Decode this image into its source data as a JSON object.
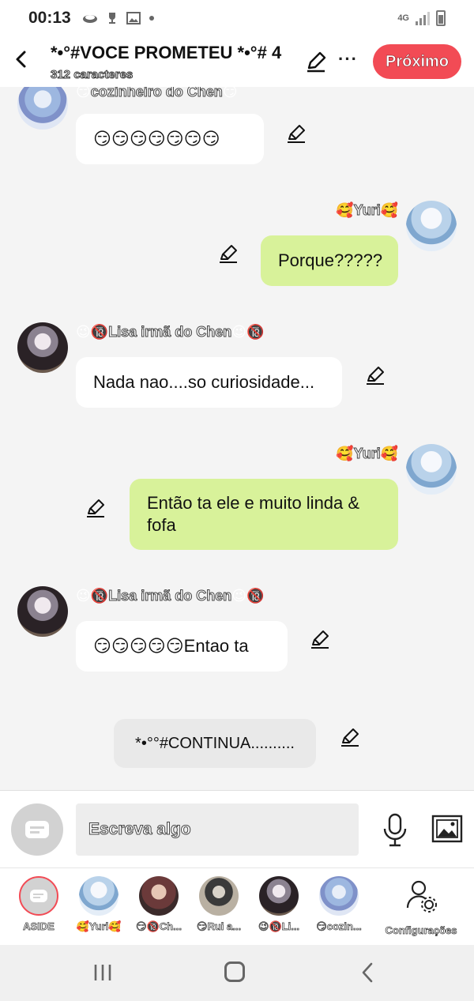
{
  "status": {
    "time": "00:13",
    "network": "4G",
    "icons": [
      "cloud-icon",
      "trophy-icon",
      "image-icon",
      "dot-icon",
      "signal-icon",
      "battery-icon"
    ]
  },
  "header": {
    "title": "*•°#VOCE PROMETEU *•°# 4",
    "subtitle": "312 caracteres",
    "next_label": "Próximo"
  },
  "messages": [
    {
      "side": "left",
      "avatar": "blue",
      "name": "cozinheiro do Chen",
      "name_prefix": "😏",
      "name_suffix": "😏",
      "text": "😏😏😏😏😏😏😏"
    },
    {
      "side": "right",
      "avatar": "yuri",
      "name": "Yuri",
      "name_prefix": "🥰",
      "name_suffix": "🥰",
      "text": "Porque?????"
    },
    {
      "side": "left",
      "avatar": "lisa",
      "name": "Lisa irmã do Chen",
      "name_prefix": "😉🔞",
      "name_suffix": "😉🔞",
      "text": "Nada nao....so curiosidade..."
    },
    {
      "side": "right",
      "avatar": "yuri",
      "name": "Yuri",
      "name_prefix": "🥰",
      "name_suffix": "🥰",
      "text": "Então ta ele e muito linda & fofa"
    },
    {
      "side": "left",
      "avatar": "lisa",
      "name": "Lisa irmã do Chen",
      "name_prefix": "😉🔞",
      "name_suffix": "😉🔞",
      "text": "😏😏😏😏😏Entao ta"
    },
    {
      "side": "narration",
      "text": "*•°°#CONTINUA.........."
    }
  ],
  "composer": {
    "placeholder": "Escreva algo"
  },
  "characters": [
    {
      "label": "ASIDE"
    },
    {
      "label": "🥰Yuri🥰"
    },
    {
      "label": "😏🔞Ch..."
    },
    {
      "label": "😏Rui a..."
    },
    {
      "label": "😉🔞Li..."
    },
    {
      "label": "😏cozin..."
    },
    {
      "label": "Configurações"
    }
  ],
  "colors": {
    "accent": "#f24b55",
    "bubble_right": "#d8f29a",
    "bubble_left": "#ffffff",
    "background": "#f4f4f4"
  }
}
